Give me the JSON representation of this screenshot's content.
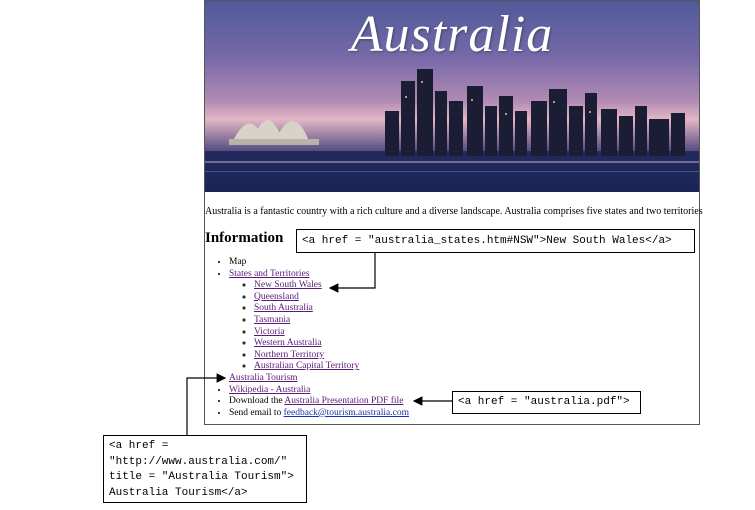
{
  "banner": {
    "title": "Australia"
  },
  "intro": "Australia is a fantastic country with a rich culture and a diverse landscape. Australia comprises five states and two territories",
  "heading": "Information",
  "list": {
    "map": "Map",
    "states": "States and Territories",
    "sub": [
      "New South Wales",
      "Queensland",
      "South Australia",
      "Tasmania",
      "Victoria",
      "Western Australia",
      "Northern Territory",
      "Australian Capital Territory"
    ],
    "tourism": "Australia Tourism",
    "wikipedia": "Wikipedia - Australia",
    "download_prefix": "Download the ",
    "download_link": "Australia Presentation PDF file",
    "email_prefix": "Send email to ",
    "email_link": "feedback@tourism.australia.com"
  },
  "callouts": {
    "nsw": "<a href = \"australia_states.htm#NSW\">New South Wales</a>",
    "pdf": "<a href = \"australia.pdf\">",
    "tourism": "<a href =\n\"http://www.australia.com/\"\ntitle = \"Australia Tourism\">\nAustralia Tourism</a>"
  },
  "colors": {
    "visited_link": "#5a1a78",
    "link": "#1a2fb0",
    "arrow": "#000000"
  }
}
